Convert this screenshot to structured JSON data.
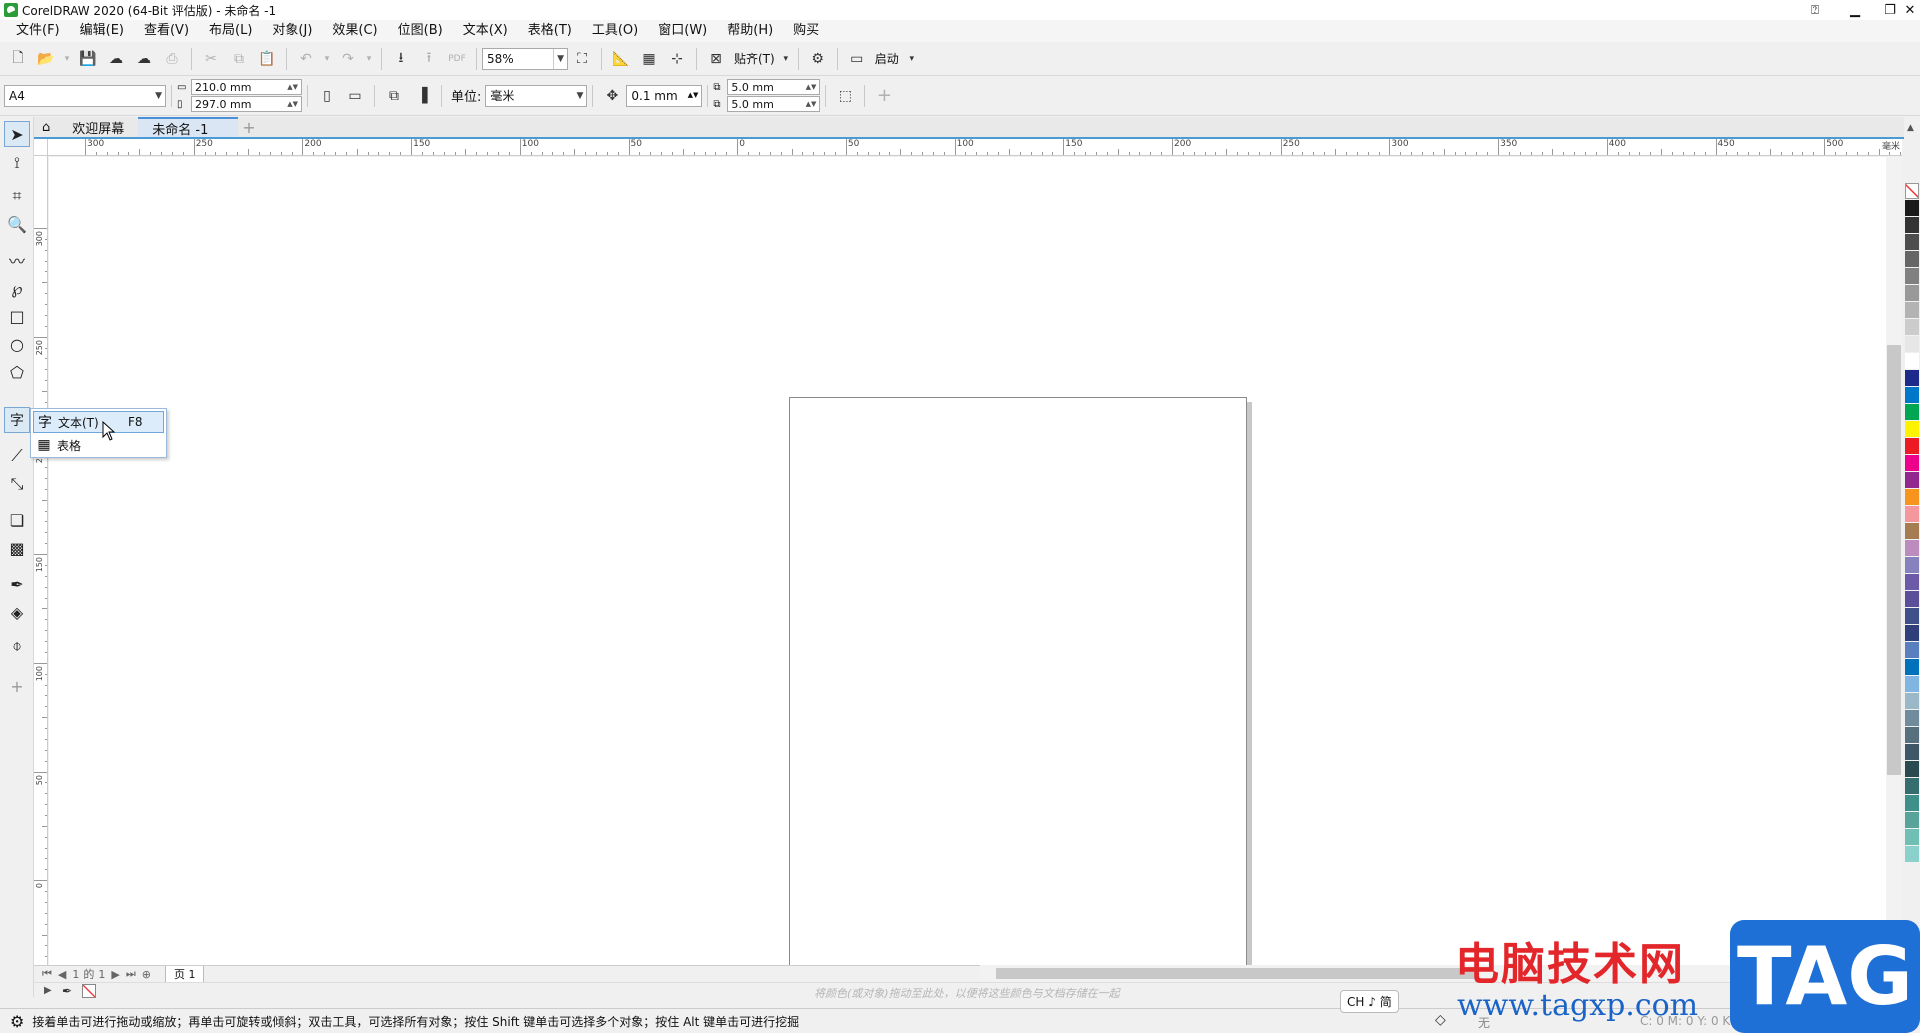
{
  "window": {
    "title": "CorelDRAW 2020 (64-Bit 评估版) - 未命名 -1"
  },
  "menu": [
    "文件(F)",
    "编辑(E)",
    "查看(V)",
    "布局(L)",
    "对象(J)",
    "效果(C)",
    "位图(B)",
    "文本(X)",
    "表格(T)",
    "工具(O)",
    "窗口(W)",
    "帮助(H)",
    "购买"
  ],
  "toolbar": {
    "zoom": "58%",
    "snap_label": "贴齐(T)",
    "launch_label": "启动"
  },
  "property_bar": {
    "page_size": "A4",
    "width": "210.0 mm",
    "height": "297.0 mm",
    "units_label": "单位:",
    "units": "毫米",
    "nudge": "0.1 mm",
    "dup_x": "5.0 mm",
    "dup_y": "5.0 mm"
  },
  "tabs": {
    "welcome": "欢迎屏幕",
    "document": "未命名 -1"
  },
  "ruler": {
    "h_labels": [
      "300",
      "250",
      "200",
      "150",
      "100",
      "50",
      "0",
      "50",
      "100",
      "150",
      "200",
      "250",
      "300",
      "350",
      "400",
      "450",
      "500"
    ],
    "h_unit": "毫米",
    "v_labels": [
      "300",
      "250",
      "200",
      "150",
      "100",
      "50",
      "0"
    ]
  },
  "flyout": {
    "text_label": "文本(T)",
    "text_shortcut": "F8",
    "table_label": "表格",
    "text_glyph": "字"
  },
  "pagenav": {
    "current": "1",
    "of_label": "的",
    "total": "1",
    "page_tab": "页 1"
  },
  "dock_hint": "将颜色(或对象)拖动至此处，以便将这些颜色与文档存储在一起",
  "status": {
    "hint": "接着单击可进行拖动或缩放；再单击可旋转或倾斜；双击工具，可选择所有对象；按住 Shift 键单击可选择多个对象；按住 Alt 键单击可进行挖掘",
    "ime": "CH ♪ 简",
    "fill_none": "无",
    "color_readout": "C: 0 M: 0 Y: 0 K: 100"
  },
  "watermark": {
    "site_name": "电脑技术网",
    "url": "www.tagxp.com",
    "logo_text": "TAG"
  },
  "colors": {
    "accent": "#4a9ad6",
    "palette": [
      "#ffffff",
      "#1a1a1a",
      "#333333",
      "#4d4d4d",
      "#666666",
      "#808080",
      "#999999",
      "#b3b3b3",
      "#cccccc",
      "#e6e6e6",
      "#ffffff",
      "#1c2a8c",
      "#0077c8",
      "#00a651",
      "#fff200",
      "#ed1c24",
      "#ec008c",
      "#92278f",
      "#f7941d",
      "#f5989d",
      "#a67c52",
      "#bd8cbf",
      "#8781bd",
      "#6c5aa8",
      "#5c4f99",
      "#3f4f8a",
      "#2e3f7a",
      "#5a7fbf",
      "#0072bc",
      "#7fb5e0",
      "#9ab8c8",
      "#708c9c",
      "#56707e",
      "#3d5766",
      "#2a4a52",
      "#366e70",
      "#3f8f8a",
      "#58a49a",
      "#6fbfb5",
      "#8ad1cc"
    ]
  }
}
